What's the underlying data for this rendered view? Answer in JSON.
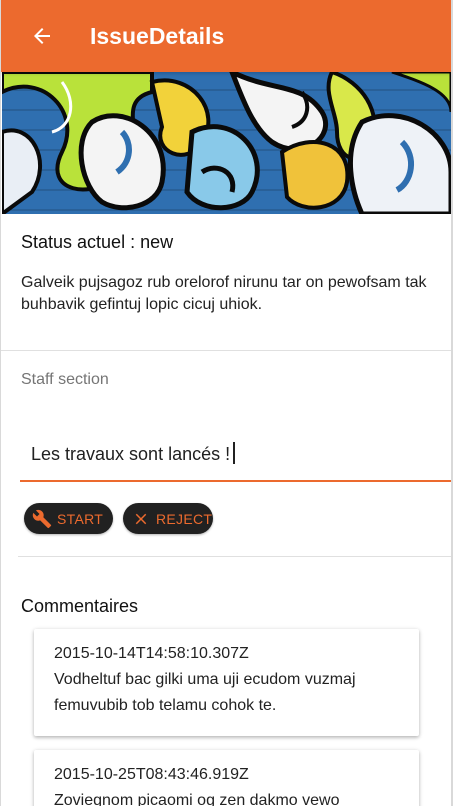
{
  "appbar": {
    "title": "IssueDetails",
    "back_icon": "arrow-back-icon"
  },
  "issue": {
    "status_text": "Status actuel : new",
    "description": "Galveik pujsagoz rub orelorof nirunu tar on pewofsam tak buhbavik gefintuj lopic cicuj uhiok."
  },
  "staff": {
    "section_label": "Staff section",
    "comment_input_value": "Les travaux sont lancés !",
    "actions": [
      {
        "label": "START",
        "icon": "wrench-icon"
      },
      {
        "label": "REJECT",
        "icon": "close-icon"
      }
    ]
  },
  "comments": {
    "title": "Commentaires",
    "items": [
      {
        "date": "2015-10-14T14:58:10.307Z",
        "text": "Vodheltuf bac gilki uma uji ecudom vuzmaj femuvubib tob telamu cohok te."
      },
      {
        "date": "2015-10-25T08:43:46.919Z",
        "text": "Zoviegnom picaomi og zen dakmo vewo"
      }
    ]
  },
  "colors": {
    "accent": "#EC6A2E",
    "chip_bg": "#212121"
  }
}
